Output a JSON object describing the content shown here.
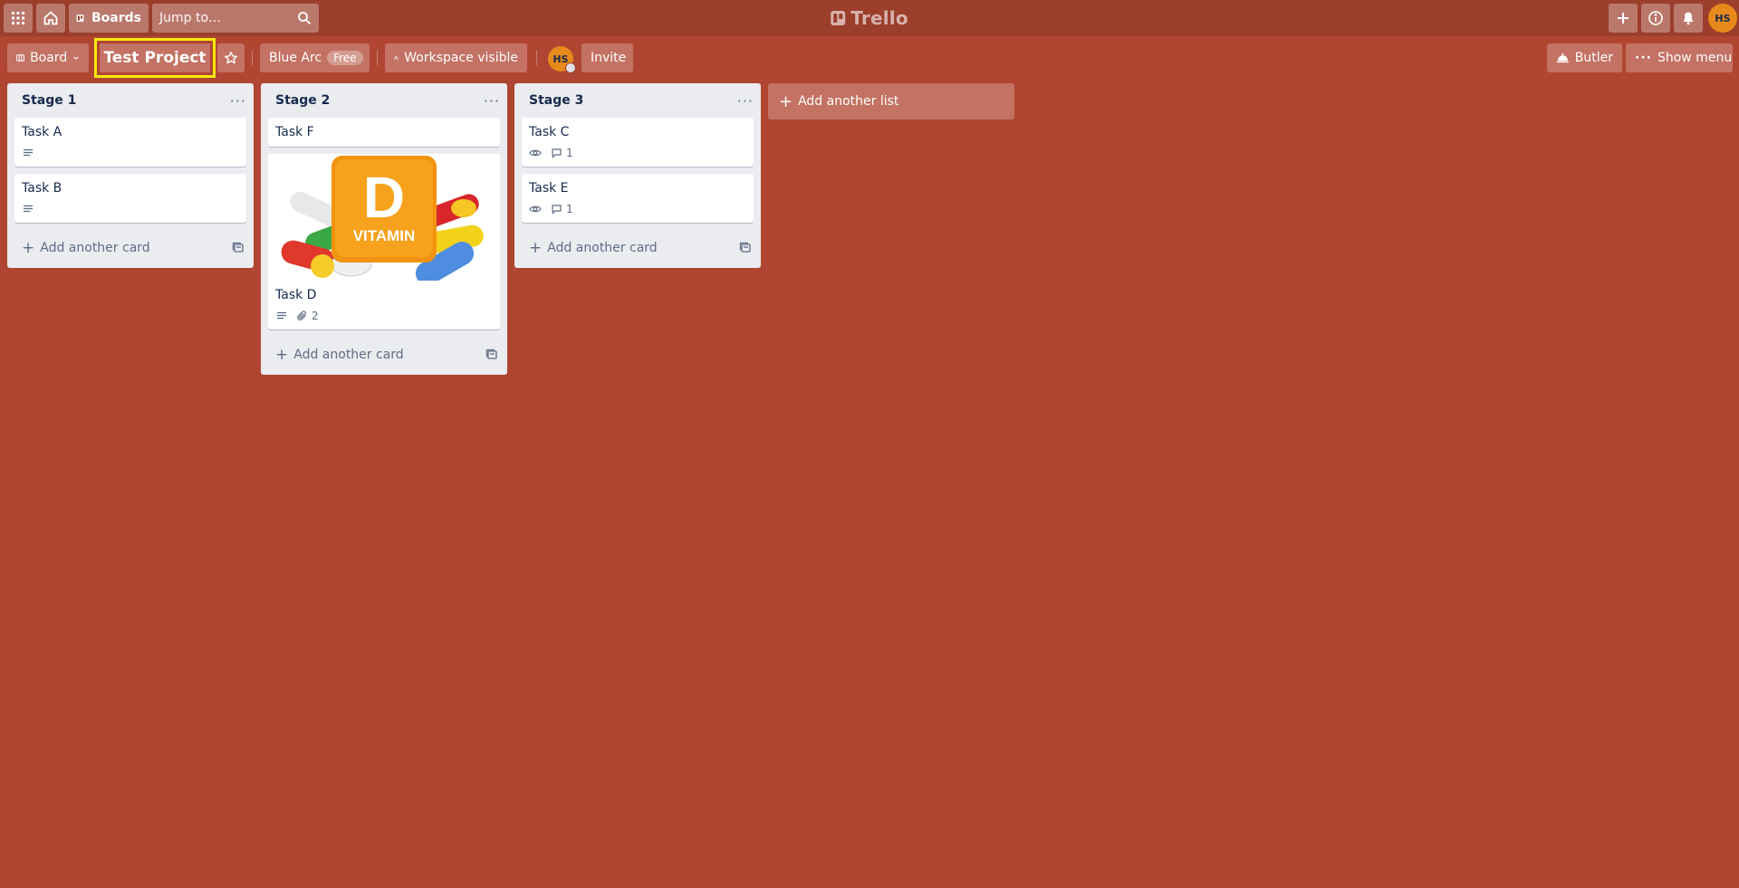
{
  "topbar": {
    "boards_label": "Boards",
    "search_placeholder": "Jump to…",
    "logo_text": "Trello",
    "user_initials": "HS"
  },
  "header": {
    "view_label": "Board",
    "board_title": "Test Project",
    "workspace_name": "Blue Arc",
    "plan_badge": "Free",
    "visibility_label": "Workspace visible",
    "member_initials": "HS",
    "invite_label": "Invite",
    "butler_label": "Butler",
    "menu_label": "Show menu"
  },
  "colors": {
    "board_bg": "#b04632",
    "topbar_bg": "#9c3e2c",
    "highlight": "#f5e90a",
    "avatar": "#e8891b"
  },
  "lists": [
    {
      "title": "Stage 1",
      "cards": [
        {
          "title": "Task A"
        },
        {
          "title": "Task B"
        }
      ],
      "add_card_label": "Add another card"
    },
    {
      "title": "Stage 2",
      "cards": [
        {
          "title": "Task F"
        },
        {
          "title": "Task D",
          "cover_text": "VITAMIN",
          "cover_letter": "D",
          "attachments": "2"
        }
      ],
      "add_card_label": "Add another card"
    },
    {
      "title": "Stage 3",
      "cards": [
        {
          "title": "Task C",
          "comments": "1"
        },
        {
          "title": "Task E",
          "comments": "1"
        }
      ],
      "add_card_label": "Add another card"
    }
  ],
  "add_list_label": "Add another list"
}
